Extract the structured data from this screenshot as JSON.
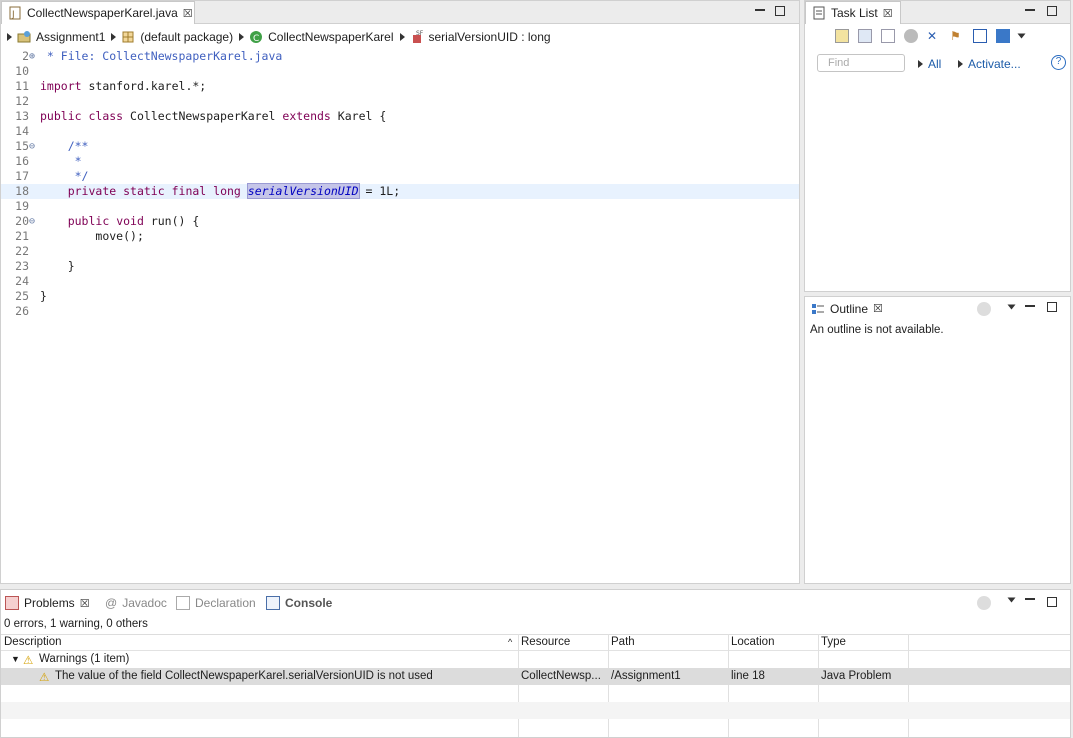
{
  "editor": {
    "tab_title": "CollectNewspaperKarel.java",
    "breadcrumbs": [
      "Assignment1",
      "(default package)",
      "CollectNewspaperKarel",
      "serialVersionUID : long"
    ],
    "lines": [
      {
        "num": "2",
        "marker": "⊕",
        "text": " * File: CollectNewspaperKarel.java"
      },
      {
        "num": "10",
        "text": ""
      },
      {
        "num": "11",
        "text": "import stanford.karel.*;"
      },
      {
        "num": "12",
        "text": ""
      },
      {
        "num": "13",
        "text": "public class CollectNewspaperKarel extends Karel {"
      },
      {
        "num": "14",
        "text": ""
      },
      {
        "num": "15",
        "marker": "⊖",
        "text": "    /**"
      },
      {
        "num": "16",
        "text": "     *"
      },
      {
        "num": "17",
        "text": "     */"
      },
      {
        "num": "18",
        "text": "    private static final long serialVersionUID = 1L;"
      },
      {
        "num": "19",
        "text": ""
      },
      {
        "num": "20",
        "marker": "⊖",
        "text": "    public void run() {"
      },
      {
        "num": "21",
        "text": "        move();"
      },
      {
        "num": "22",
        "text": ""
      },
      {
        "num": "23",
        "text": "    }"
      },
      {
        "num": "24",
        "text": ""
      },
      {
        "num": "25",
        "text": "}"
      },
      {
        "num": "26",
        "text": ""
      }
    ]
  },
  "tasklist": {
    "title": "Task List",
    "find_placeholder": "Find",
    "all_label": "All",
    "activate_label": "Activate..."
  },
  "outline": {
    "title": "Outline",
    "message": "An outline is not available."
  },
  "problems": {
    "tabs": [
      "Problems",
      "Javadoc",
      "Declaration",
      "Console"
    ],
    "summary": "0 errors, 1 warning, 0 others",
    "columns": [
      "Description",
      "Resource",
      "Path",
      "Location",
      "Type"
    ],
    "group_label": "Warnings (1 item)",
    "row": {
      "description": "The value of the field CollectNewspaperKarel.serialVersionUID is not used",
      "resource": "CollectNewsp...",
      "path": "/Assignment1",
      "location": "line 18",
      "type": "Java Problem"
    }
  }
}
